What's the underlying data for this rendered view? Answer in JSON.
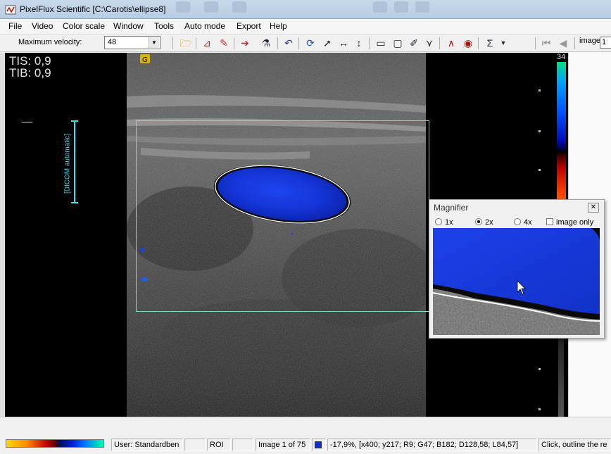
{
  "window": {
    "title": "PixelFlux Scientific [C:\\Carotis\\ellipse8]"
  },
  "menu": [
    "File",
    "Video",
    "Color scale",
    "Window",
    "Tools",
    "Auto mode",
    "Export",
    "Help"
  ],
  "toolbar": {
    "velocity_label": "Maximum velocity:",
    "velocity_value": "48",
    "image_label": "image",
    "image_value": "1",
    "icons": [
      "open-folder-icon",
      "graph-icon",
      "pipette-icon",
      "marker-icon",
      "lab-icon",
      "undo-icon",
      "refresh-icon",
      "pointer-select-icon",
      "horizontal-arrows-icon",
      "vertical-arrows-icon",
      "ruler-icon",
      "rectangle-icon",
      "pen-icon",
      "polyline-icon",
      "spectrum-icon",
      "color-wheel-icon",
      "sum-icon",
      "dropdown-icon",
      "first-frame-icon",
      "previous-frame-icon"
    ]
  },
  "viewer": {
    "tis": "TIS: 0,9",
    "tib": "TIB: 0,9",
    "dicom_label": "[DICOM automatic]",
    "scale_max": "34"
  },
  "magnifier": {
    "title": "Magnifier",
    "options": [
      "1x",
      "2x",
      "4x"
    ],
    "selected": "2x",
    "image_only_label": "image only",
    "image_only_checked": false
  },
  "status": {
    "user": "User: Standardben",
    "mode": "ROI",
    "frame": "Image 1 of 75",
    "pixel_info": "-17,9%, [x400; y217; R9; G47; B182; D128,58; L84,57]",
    "hint": "Click, outline the re"
  },
  "colors": {
    "roi_border": "#8ed7a2",
    "flow_blue": "#1030d0",
    "accent_cyan": "#35e0f0"
  }
}
